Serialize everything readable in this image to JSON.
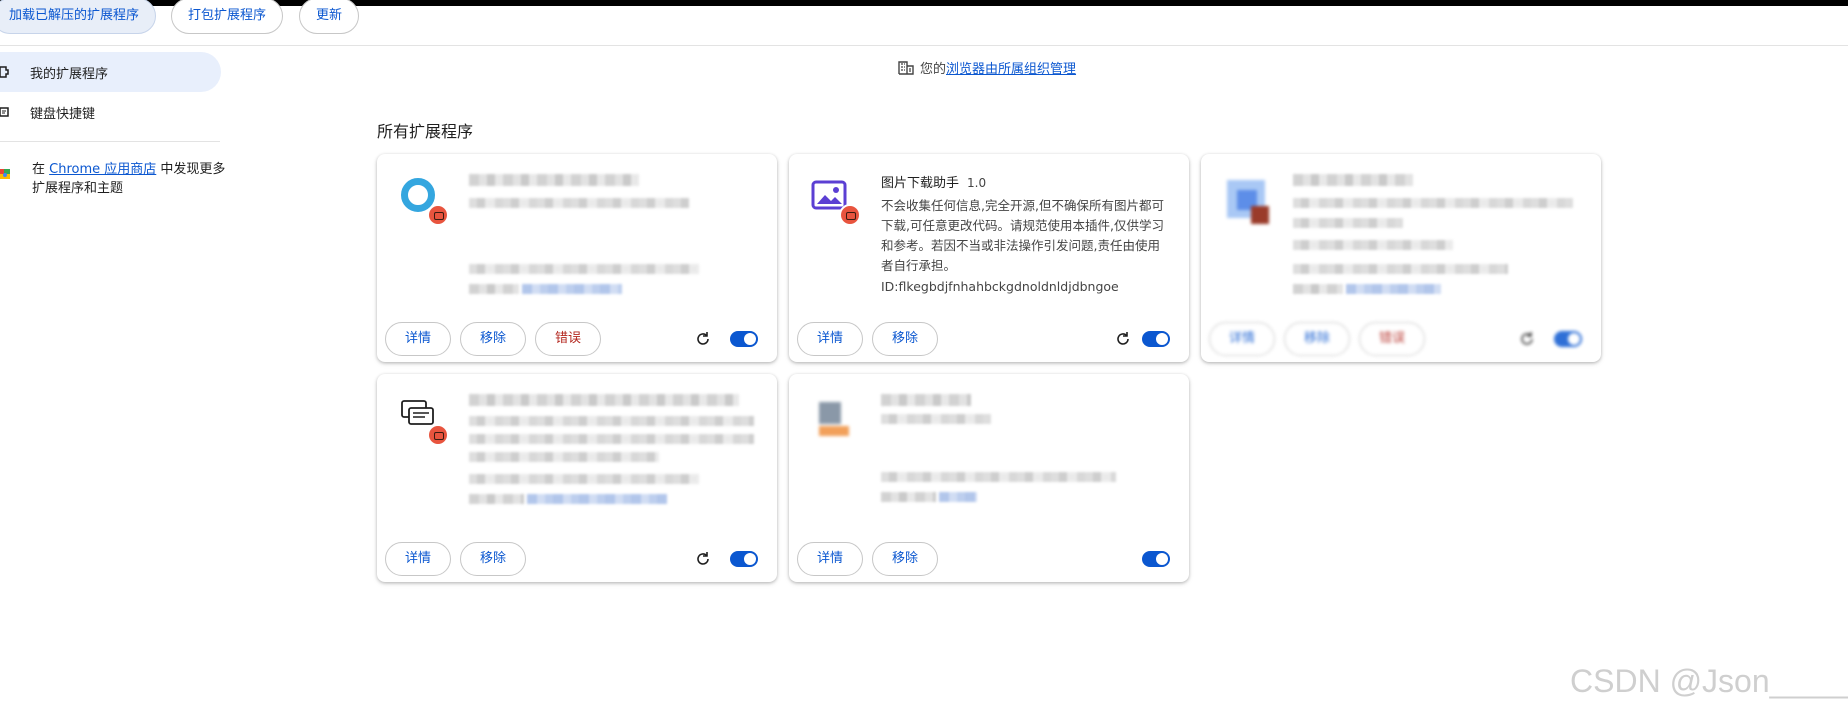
{
  "toolbar": {
    "load_unpacked": "加载已解压的扩展程序",
    "pack": "打包扩展程序",
    "update": "更新"
  },
  "sidebar": {
    "items": [
      {
        "label": "我的扩展程序"
      },
      {
        "label": "键盘快捷键"
      }
    ],
    "store_prefix": "在 ",
    "store_link": "Chrome 应用商店",
    "store_suffix": " 中发现更多扩展程序和主题"
  },
  "managed": {
    "prefix": "您的",
    "link": "浏览器由所属组织管理"
  },
  "section_title": "所有扩展程序",
  "cards": [
    {
      "details": "详情",
      "remove": "移除",
      "errors": "错误"
    },
    {
      "name": "图片下载助手",
      "version": "1.0",
      "description": "不会收集任何信息,完全开源,但不确保所有图片都可下载,可任意更改代码。请规范使用本插件,仅供学习和参考。若因不当或非法操作引发问题,责任由使用者自行承担。",
      "id_label": "ID:",
      "id": "flkegbdjfnhahbckgdnoldnldjdbngoe",
      "details": "详情",
      "remove": "移除"
    },
    {
      "details": "详情",
      "remove": "移除",
      "errors": "错误"
    },
    {
      "details": "详情",
      "remove": "移除"
    },
    {
      "details": "详情",
      "remove": "移除"
    }
  ],
  "watermark": "CSDN @Json_____",
  "colors": {
    "accent": "#0b57d0",
    "error": "#b3261e",
    "active_nav": "#e8effc"
  }
}
